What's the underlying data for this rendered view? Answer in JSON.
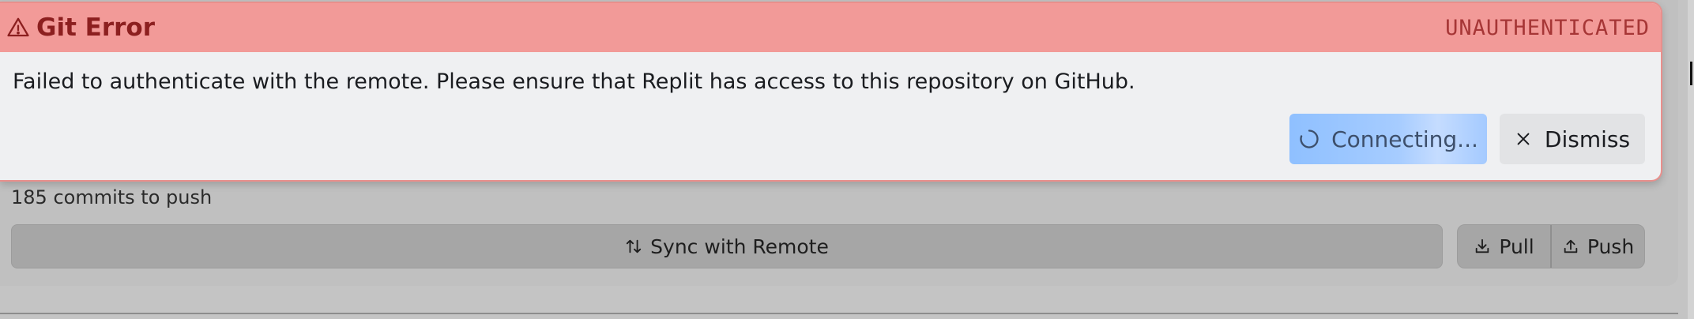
{
  "error": {
    "title": "Git Error",
    "code": "UNAUTHENTICATED",
    "message": "Failed to authenticate with the remote. Please ensure that Replit has access to this repository on GitHub.",
    "connect_label": "Connecting...",
    "dismiss_label": "Dismiss"
  },
  "git_panel": {
    "commits_text": "185 commits to push",
    "sync_label": "Sync with Remote",
    "pull_label": "Pull",
    "push_label": "Push"
  },
  "colors": {
    "error_header_bg": "#f29a98",
    "error_title": "#8c1f1f",
    "primary_button": "#8fc0ff"
  },
  "icons": {
    "title": "warning-triangle-icon",
    "connect": "spinner-icon",
    "dismiss": "close-icon",
    "sync": "sort-arrows-icon",
    "pull": "download-icon",
    "push": "upload-icon"
  }
}
